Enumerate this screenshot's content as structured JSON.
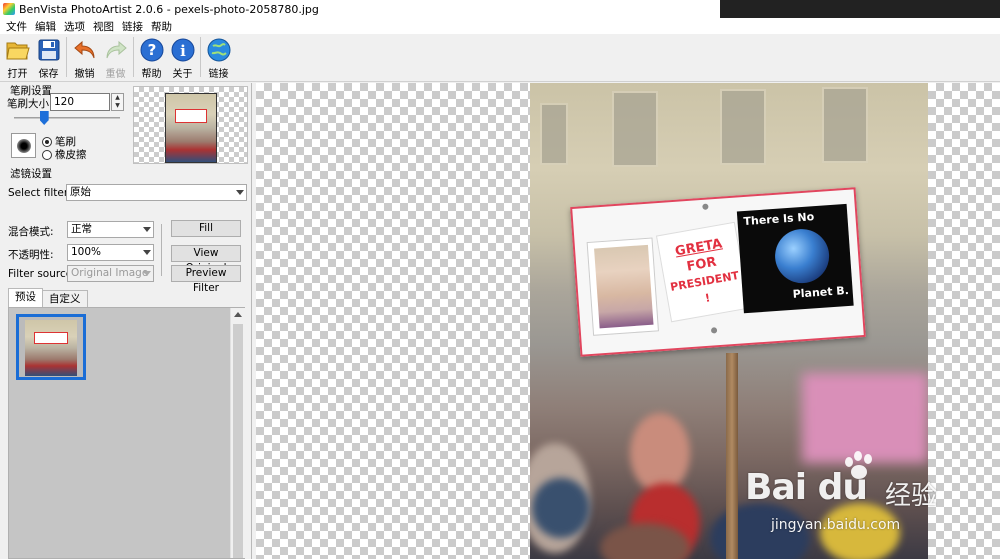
{
  "window": {
    "title": "BenVista PhotoArtist 2.0.6 - pexels-photo-2058780.jpg"
  },
  "menu": [
    {
      "key": "file",
      "label": "文件"
    },
    {
      "key": "edit",
      "label": "编辑"
    },
    {
      "key": "options",
      "label": "选项"
    },
    {
      "key": "view",
      "label": "视图"
    },
    {
      "key": "link",
      "label": "链接"
    },
    {
      "key": "help",
      "label": "帮助"
    }
  ],
  "toolbar": {
    "open": "打开",
    "save": "保存",
    "undo": "撤销",
    "redo": "重做",
    "help": "帮助",
    "about": "关于",
    "link": "链接"
  },
  "brush": {
    "section_title": "笔刷设置",
    "size_label": "笔刷大小:",
    "size_value": "120",
    "size_percent": 28,
    "mode_brush": "笔刷",
    "mode_eraser": "橡皮擦",
    "selected_mode": "brush"
  },
  "filter": {
    "section_title": "滤镜设置",
    "select_label": "Select filter:",
    "select_value": "原始",
    "blend_label": "混合模式:",
    "blend_value": "正常",
    "opacity_label": "不透明性:",
    "opacity_value": "100%",
    "source_label": "Filter source:",
    "source_value": "Original Image",
    "fill_button": "Fill",
    "view_original_button": "View Original",
    "preview_filter_button": "Preview Filter"
  },
  "tabs": {
    "preset": "预设",
    "custom": "自定义",
    "active": "preset"
  },
  "photo": {
    "sign_greta": "GRETA",
    "sign_for": "FOR",
    "sign_president": "PRESIDENT !",
    "sign_there_is_no": "There Is No",
    "sign_planet_b": "Planet B."
  },
  "watermark": {
    "logo": "Bai du",
    "sub": "经验",
    "url": "jingyan.baidu.com"
  },
  "colors": {
    "accent": "#1a6dd6",
    "sign_red": "#e23040",
    "checker": "#cbcbcb"
  }
}
